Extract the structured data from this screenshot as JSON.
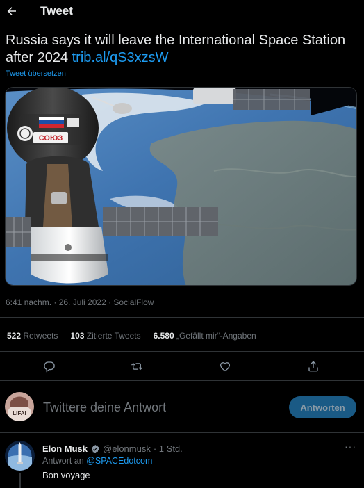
{
  "header": {
    "title": "Tweet",
    "back_icon": "arrow-left-icon"
  },
  "tweet": {
    "text": "Russia says it will leave the International Space Station after 2024 ",
    "link": "trib.al/qS3xzsW",
    "translate_label": "Tweet übersetzen",
    "timestamp": "6:41 nachm. · 26. Juli 2022 · SocialFlow",
    "media_description": "Soyuz spacecraft docked at the ISS above Earth"
  },
  "stats": {
    "retweets_count": "522",
    "retweets_label": "Retweets",
    "quotes_count": "103",
    "quotes_label": "Zitierte Tweets",
    "likes_count": "6.580",
    "likes_label": "„Gefällt mir“-Angaben"
  },
  "actions": [
    "reply-icon",
    "retweet-icon",
    "like-icon",
    "share-icon"
  ],
  "compose": {
    "placeholder": "Twittere deine Antwort",
    "button_label": "Antworten"
  },
  "reply": {
    "name": "Elon Musk",
    "handle": "@elonmusk",
    "time": "· 1 Std.",
    "reply_to_prefix": "Antwort an ",
    "reply_to_mention": "@SPACEdotcom",
    "text": "Bon voyage",
    "more_icon": "more-icon"
  },
  "colors": {
    "accent": "#1d9bf0",
    "background": "#000000",
    "muted": "#71767b",
    "border": "#2f3336"
  }
}
